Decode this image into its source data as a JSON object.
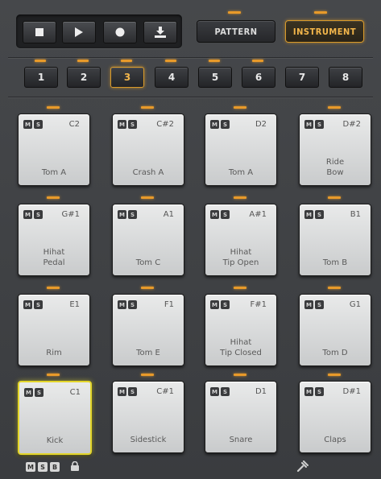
{
  "transport": {
    "stop_icon": "stop-icon",
    "play_icon": "play-icon",
    "record_icon": "record-icon",
    "export_icon": "export-icon"
  },
  "modes": {
    "pattern_label": "PATTERN",
    "instrument_label": "INSTRUMENT",
    "active": "instrument"
  },
  "banks": {
    "labels": [
      "1",
      "2",
      "3",
      "4",
      "5",
      "6",
      "7",
      "8"
    ],
    "active": "3"
  },
  "pad_buttons": {
    "mute": "M",
    "solo": "S"
  },
  "pads": [
    {
      "note": "C2",
      "name": "Tom A"
    },
    {
      "note": "C#2",
      "name": "Crash A"
    },
    {
      "note": "D2",
      "name": "Tom A"
    },
    {
      "note": "D#2",
      "name": "Ride\nBow"
    },
    {
      "note": "G#1",
      "name": "Hihat\nPedal"
    },
    {
      "note": "A1",
      "name": "Tom C"
    },
    {
      "note": "A#1",
      "name": "Hihat\nTip Open"
    },
    {
      "note": "B1",
      "name": "Tom B"
    },
    {
      "note": "E1",
      "name": "Rim"
    },
    {
      "note": "F1",
      "name": "Tom E"
    },
    {
      "note": "F#1",
      "name": "Hihat\nTip Closed"
    },
    {
      "note": "G1",
      "name": "Tom D"
    },
    {
      "note": "C1",
      "name": "Kick"
    },
    {
      "note": "C#1",
      "name": "Sidestick"
    },
    {
      "note": "D1",
      "name": "Snare"
    },
    {
      "note": "D#1",
      "name": "Claps"
    }
  ],
  "selected_pad": "Kick",
  "footer": {
    "m": "M",
    "s": "S",
    "b": "B",
    "lock_icon": "lock-icon",
    "tuner_icon": "tuning-fork-icon"
  },
  "colors": {
    "accent": "#e89a2a",
    "selected_pad": "#e3d62a",
    "panel": "#3d3f42"
  }
}
